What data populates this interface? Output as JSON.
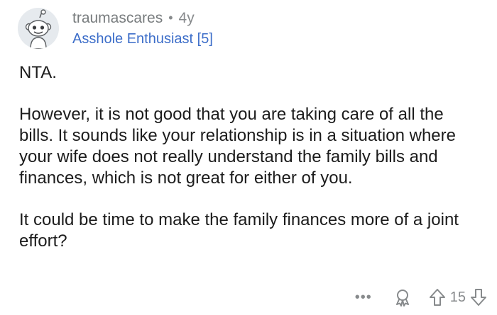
{
  "comment": {
    "username": "traumascares",
    "separator": "•",
    "age": "4y",
    "flair": "Asshole Enthusiast [5]",
    "paragraphs": [
      "NTA.",
      "However, it is not good that you are taking care of all the bills. It sounds like your relationship is in a situation where your wife does not really understand the family bills and finances, which is not great for either of you.",
      "It could be time to make the family finances more of a joint effort?"
    ],
    "actions": {
      "more_label": "•••",
      "vote_count": "15"
    }
  },
  "icons": {
    "avatar": "reddit-snoo-avatar-icon",
    "award": "award-icon",
    "upvote": "upvote-arrow-icon",
    "downvote": "downvote-arrow-icon"
  },
  "colors": {
    "flair": "#3d6ec9",
    "muted": "#878a8c",
    "text": "#1c1c1c"
  }
}
